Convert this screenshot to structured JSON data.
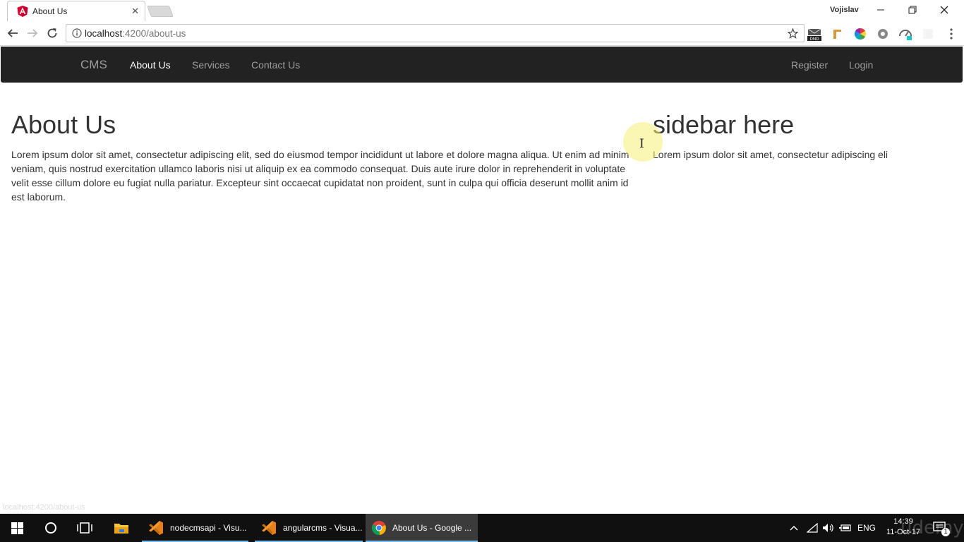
{
  "browser": {
    "tab_title": "About Us",
    "profile_name": "Vojislav",
    "url_host": "localhost",
    "url_path": ":4200/about-us",
    "status_url": "localhost:4200/about-us"
  },
  "site": {
    "brand": "CMS",
    "nav": {
      "about": "About Us",
      "services": "Services",
      "contact": "Contact Us",
      "register": "Register",
      "login": "Login"
    },
    "active_nav": "About Us"
  },
  "content": {
    "heading": "About Us",
    "body": "Lorem ipsum dolor sit amet, consectetur adipiscing elit, sed do eiusmod tempor incididunt ut labore et dolore magna aliqua. Ut enim ad minim veniam, quis nostrud exercitation ullamco laboris nisi ut aliquip ex ea commodo consequat. Duis aute irure dolor in reprehenderit in voluptate velit esse cillum dolore eu fugiat nulla pariatur. Excepteur sint occaecat cupidatat non proident, sunt in culpa qui officia deserunt mollit anim id est laborum."
  },
  "sidebar": {
    "heading": "sidebar here",
    "body": "Lorem ipsum dolor sit amet, consectetur adipiscing eli"
  },
  "taskbar": {
    "apps": [
      {
        "label": "nodecmsapi - Visu...",
        "icon": "vscode-icon"
      },
      {
        "label": "angularcms - Visua...",
        "icon": "vscode-icon"
      },
      {
        "label": "About Us - Google ...",
        "icon": "chrome-icon"
      }
    ],
    "language": "ENG",
    "time": "14:39",
    "date": "11-Oct-17",
    "notification_count": "1"
  },
  "colors": {
    "navbar_bg": "#222222",
    "nav_link": "#9d9d9d",
    "nav_active": "#ffffff",
    "taskbar_bg": "#101010",
    "taskbar_accent": "#76b9ed"
  },
  "watermark": "udemy"
}
